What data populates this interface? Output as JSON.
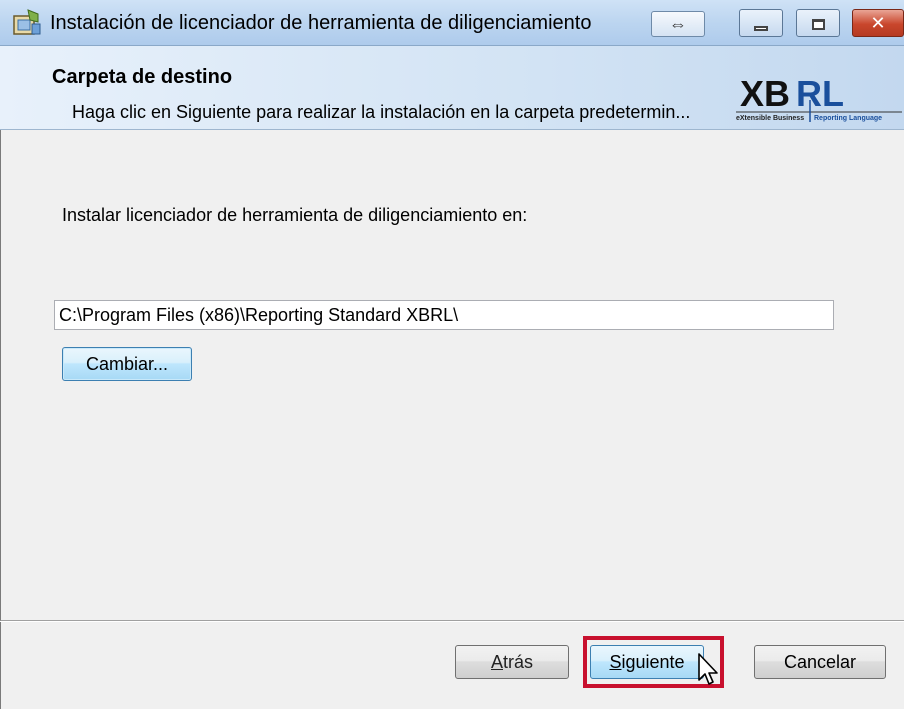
{
  "window": {
    "title": "Instalación de licenciador de herramienta de diligenciamiento",
    "swap_glyph": "⇔",
    "icons": [
      "installer-icon",
      "swap-icon",
      "minimize-icon",
      "maximize-icon",
      "close-icon"
    ],
    "close_glyph": "✕"
  },
  "banner": {
    "title": "Carpeta de destino",
    "subtitle": "Haga clic en Siguiente para realizar la instalación en la carpeta predetermin...",
    "logo": {
      "text_xb": "XB",
      "text_rl": "RL",
      "tagline_left": "eXtensible Business",
      "tagline_right": "Reporting Language"
    }
  },
  "body": {
    "install_label": "Instalar licenciador de herramienta de diligenciamiento en:",
    "path_value": "C:\\Program Files (x86)\\Reporting Standard XBRL\\",
    "change_button": "Cambiar..."
  },
  "footer": {
    "back_accel": "A",
    "back_rest": "trás",
    "next_accel": "S",
    "next_rest": "iguiente",
    "cancel": "Cancelar"
  },
  "colors": {
    "highlight": "#c8102e",
    "title_gradient_top": "#cfe2f6",
    "panel_bg": "#f0f0f0",
    "focus_blue": "#3c7fb1"
  }
}
